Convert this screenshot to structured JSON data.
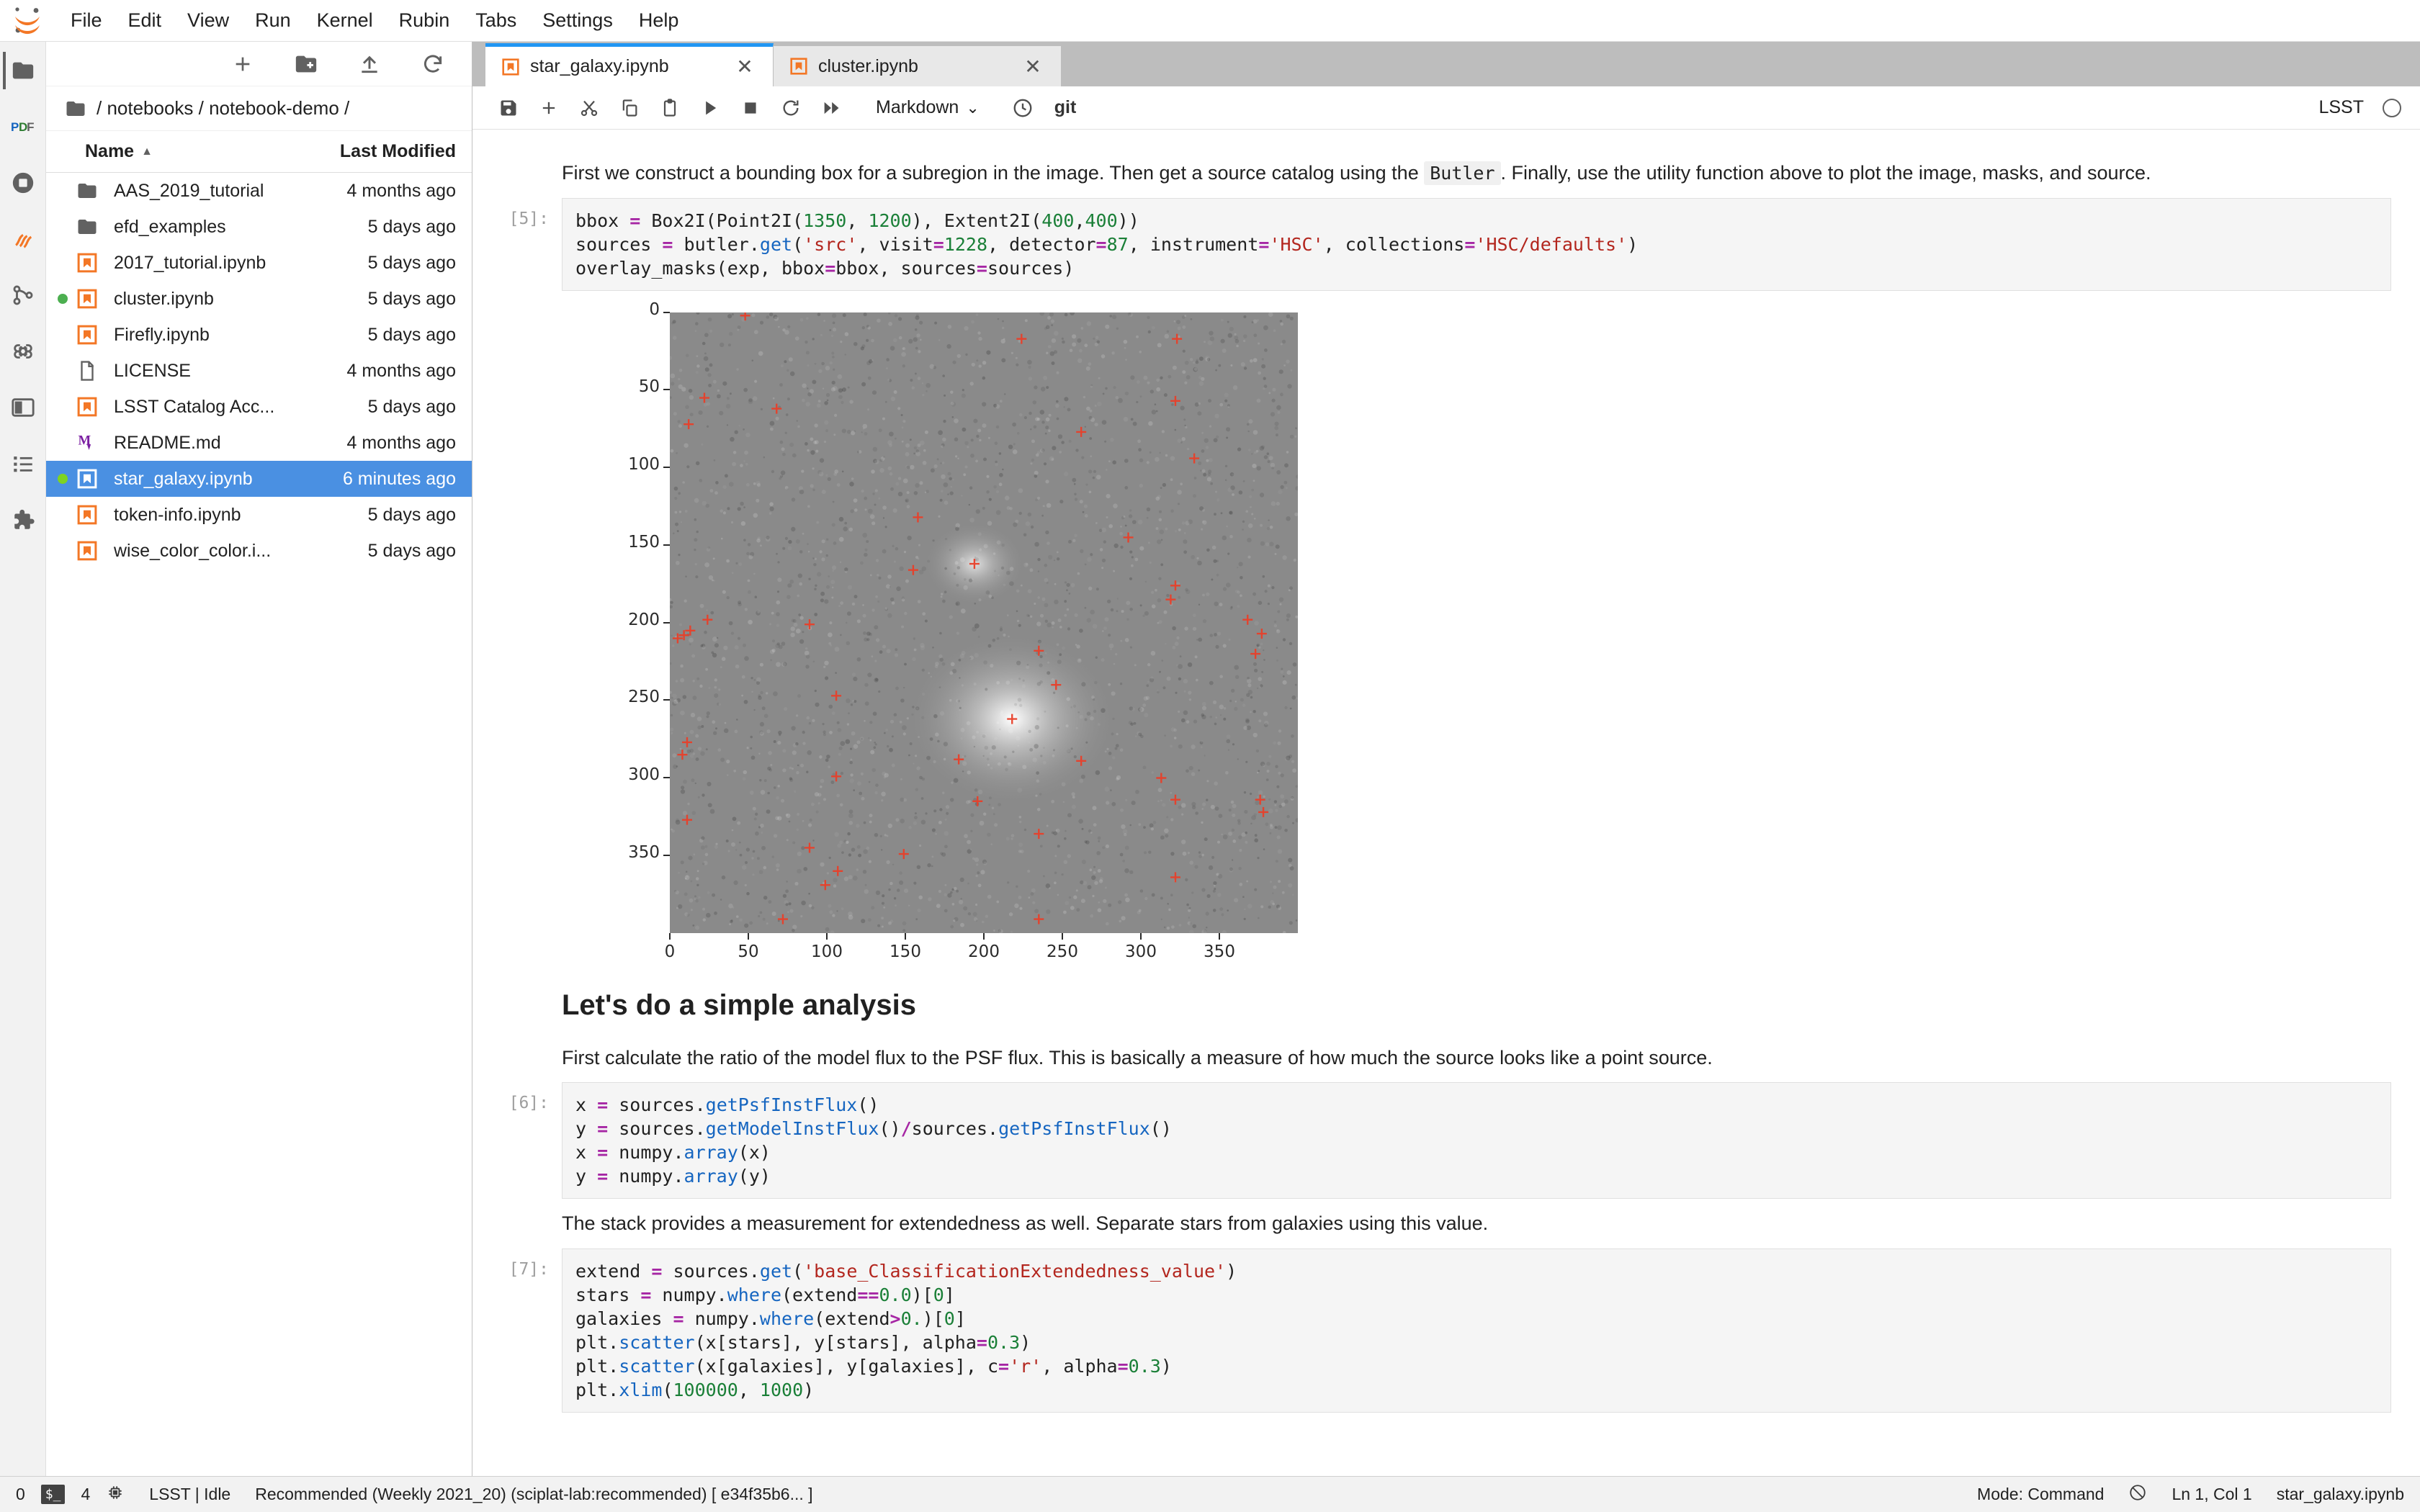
{
  "app": {
    "logo_icon": "jupyter-logo-icon",
    "menu": [
      "File",
      "Edit",
      "View",
      "Run",
      "Kernel",
      "Rubin",
      "Tabs",
      "Settings",
      "Help"
    ]
  },
  "activitybar": {
    "items": [
      {
        "name": "file-browser-icon",
        "label": "File Browser"
      },
      {
        "name": "pdf-icon",
        "label": "PDF"
      },
      {
        "name": "running-icon",
        "label": "Running Terminals and Kernels"
      },
      {
        "name": "dask-icon",
        "label": "Dask"
      },
      {
        "name": "git-icon",
        "label": "Git"
      },
      {
        "name": "commands-icon",
        "label": "Commands"
      },
      {
        "name": "property-inspector-icon",
        "label": "Property Inspector"
      },
      {
        "name": "toc-icon",
        "label": "Table of Contents"
      },
      {
        "name": "extensions-icon",
        "label": "Extension Manager"
      }
    ]
  },
  "filebrowser": {
    "toolbar": [
      {
        "name": "new-launcher-button",
        "icon": "plus-icon"
      },
      {
        "name": "new-folder-button",
        "icon": "folder-plus-icon"
      },
      {
        "name": "upload-button",
        "icon": "upload-icon"
      },
      {
        "name": "refresh-button",
        "icon": "refresh-icon"
      }
    ],
    "breadcrumb": "/ notebooks / notebook-demo /",
    "columns": {
      "name": "Name",
      "modified": "Last Modified"
    },
    "sort_caret": "▲",
    "items": [
      {
        "name": "AAS_2019_tutorial",
        "modified": "4 months ago",
        "type": "folder",
        "selected": false,
        "running": false
      },
      {
        "name": "efd_examples",
        "modified": "5 days ago",
        "type": "folder",
        "selected": false,
        "running": false
      },
      {
        "name": "2017_tutorial.ipynb",
        "modified": "5 days ago",
        "type": "notebook",
        "selected": false,
        "running": false
      },
      {
        "name": "cluster.ipynb",
        "modified": "5 days ago",
        "type": "notebook",
        "selected": false,
        "running": true
      },
      {
        "name": "Firefly.ipynb",
        "modified": "5 days ago",
        "type": "notebook",
        "selected": false,
        "running": false
      },
      {
        "name": "LICENSE",
        "modified": "4 months ago",
        "type": "file",
        "selected": false,
        "running": false
      },
      {
        "name": "LSST Catalog Acc...",
        "modified": "5 days ago",
        "type": "notebook",
        "selected": false,
        "running": false
      },
      {
        "name": "README.md",
        "modified": "4 months ago",
        "type": "markdown",
        "selected": false,
        "running": false
      },
      {
        "name": "star_galaxy.ipynb",
        "modified": "6 minutes ago",
        "type": "notebook",
        "selected": true,
        "running": true
      },
      {
        "name": "token-info.ipynb",
        "modified": "5 days ago",
        "type": "notebook",
        "selected": false,
        "running": false
      },
      {
        "name": "wise_color_color.i...",
        "modified": "5 days ago",
        "type": "notebook",
        "selected": false,
        "running": false
      }
    ]
  },
  "tabs": [
    {
      "label": "star_galaxy.ipynb",
      "close": "✕",
      "active": true
    },
    {
      "label": "cluster.ipynb",
      "close": "✕",
      "active": false
    }
  ],
  "notebook_toolbar": {
    "buttons": [
      {
        "name": "save-button",
        "icon": "save-icon"
      },
      {
        "name": "insert-cell-button",
        "icon": "plus-icon"
      },
      {
        "name": "cut-cell-button",
        "icon": "scissors-icon"
      },
      {
        "name": "copy-cell-button",
        "icon": "copy-icon"
      },
      {
        "name": "paste-cell-button",
        "icon": "paste-icon"
      },
      {
        "name": "run-cell-button",
        "icon": "play-icon"
      },
      {
        "name": "interrupt-kernel-button",
        "icon": "stop-icon"
      },
      {
        "name": "restart-kernel-button",
        "icon": "refresh-icon"
      },
      {
        "name": "restart-run-all-button",
        "icon": "fast-forward-icon"
      }
    ],
    "cell_type": "Markdown",
    "cell_type_caret": "⌄",
    "history_icon": "clock-icon",
    "git_label": "git",
    "kernel_name": "LSST"
  },
  "notebook": {
    "cells": [
      {
        "id": "md-intro",
        "type": "markdown",
        "prompt": "",
        "segments": [
          {
            "t": "text",
            "v": "First we construct a bounding box for a subregion in the image. Then get a source catalog using the "
          },
          {
            "t": "code",
            "v": "Butler"
          },
          {
            "t": "text",
            "v": ". Finally, use the utility function above to plot the image, masks, and source."
          }
        ]
      },
      {
        "id": "code-5",
        "type": "code",
        "prompt": "[5]:",
        "lines": [
          [
            {
              "t": "p",
              "v": "bbox "
            },
            {
              "t": "op",
              "v": "="
            },
            {
              "t": "p",
              "v": " Box2I(Point2I("
            },
            {
              "t": "num",
              "v": "1350"
            },
            {
              "t": "p",
              "v": ", "
            },
            {
              "t": "num",
              "v": "1200"
            },
            {
              "t": "p",
              "v": "), Extent2I("
            },
            {
              "t": "num",
              "v": "400"
            },
            {
              "t": "p",
              "v": ","
            },
            {
              "t": "num",
              "v": "400"
            },
            {
              "t": "p",
              "v": "))"
            }
          ],
          [
            {
              "t": "p",
              "v": "sources "
            },
            {
              "t": "op",
              "v": "="
            },
            {
              "t": "p",
              "v": " butler."
            },
            {
              "t": "fn",
              "v": "get"
            },
            {
              "t": "p",
              "v": "("
            },
            {
              "t": "str",
              "v": "'src'"
            },
            {
              "t": "p",
              "v": ", visit"
            },
            {
              "t": "op",
              "v": "="
            },
            {
              "t": "num",
              "v": "1228"
            },
            {
              "t": "p",
              "v": ", detector"
            },
            {
              "t": "op",
              "v": "="
            },
            {
              "t": "num",
              "v": "87"
            },
            {
              "t": "p",
              "v": ", instrument"
            },
            {
              "t": "op",
              "v": "="
            },
            {
              "t": "str",
              "v": "'HSC'"
            },
            {
              "t": "p",
              "v": ", collections"
            },
            {
              "t": "op",
              "v": "="
            },
            {
              "t": "str",
              "v": "'HSC/defaults'"
            },
            {
              "t": "p",
              "v": ")"
            }
          ],
          [
            {
              "t": "p",
              "v": "overlay_masks(exp, bbox"
            },
            {
              "t": "op",
              "v": "="
            },
            {
              "t": "p",
              "v": "bbox, sources"
            },
            {
              "t": "op",
              "v": "="
            },
            {
              "t": "p",
              "v": "sources)"
            }
          ]
        ]
      },
      {
        "id": "md-analysis-heading",
        "type": "markdown-heading",
        "prompt": "",
        "text": "Let's do a simple analysis"
      },
      {
        "id": "md-analysis-body",
        "type": "markdown",
        "prompt": "",
        "segments": [
          {
            "t": "text",
            "v": "First calculate the ratio of the model flux to the PSF flux. This is basically a measure of how much the source looks like a point source."
          }
        ]
      },
      {
        "id": "code-6",
        "type": "code",
        "prompt": "[6]:",
        "lines": [
          [
            {
              "t": "p",
              "v": "x "
            },
            {
              "t": "op",
              "v": "="
            },
            {
              "t": "p",
              "v": " sources."
            },
            {
              "t": "fn",
              "v": "getPsfInstFlux"
            },
            {
              "t": "p",
              "v": "()"
            }
          ],
          [
            {
              "t": "p",
              "v": "y "
            },
            {
              "t": "op",
              "v": "="
            },
            {
              "t": "p",
              "v": " sources."
            },
            {
              "t": "fn",
              "v": "getModelInstFlux"
            },
            {
              "t": "p",
              "v": "()"
            },
            {
              "t": "op",
              "v": "/"
            },
            {
              "t": "p",
              "v": "sources."
            },
            {
              "t": "fn",
              "v": "getPsfInstFlux"
            },
            {
              "t": "p",
              "v": "()"
            }
          ],
          [
            {
              "t": "p",
              "v": "x "
            },
            {
              "t": "op",
              "v": "="
            },
            {
              "t": "p",
              "v": " numpy."
            },
            {
              "t": "fn",
              "v": "array"
            },
            {
              "t": "p",
              "v": "(x)"
            }
          ],
          [
            {
              "t": "p",
              "v": "y "
            },
            {
              "t": "op",
              "v": "="
            },
            {
              "t": "p",
              "v": " numpy."
            },
            {
              "t": "fn",
              "v": "array"
            },
            {
              "t": "p",
              "v": "(y)"
            }
          ]
        ]
      },
      {
        "id": "md-extendedness",
        "type": "markdown",
        "prompt": "",
        "segments": [
          {
            "t": "text",
            "v": "The stack provides a measurement for extendedness as well. Separate stars from galaxies using this value."
          }
        ]
      },
      {
        "id": "code-7",
        "type": "code",
        "prompt": "[7]:",
        "lines": [
          [
            {
              "t": "p",
              "v": "extend "
            },
            {
              "t": "op",
              "v": "="
            },
            {
              "t": "p",
              "v": " sources."
            },
            {
              "t": "fn",
              "v": "get"
            },
            {
              "t": "p",
              "v": "("
            },
            {
              "t": "str",
              "v": "'base_ClassificationExtendedness_value'"
            },
            {
              "t": "p",
              "v": ")"
            }
          ],
          [
            {
              "t": "p",
              "v": "stars "
            },
            {
              "t": "op",
              "v": "="
            },
            {
              "t": "p",
              "v": " numpy."
            },
            {
              "t": "fn",
              "v": "where"
            },
            {
              "t": "p",
              "v": "(extend"
            },
            {
              "t": "op",
              "v": "=="
            },
            {
              "t": "num",
              "v": "0.0"
            },
            {
              "t": "p",
              "v": ")["
            },
            {
              "t": "num",
              "v": "0"
            },
            {
              "t": "p",
              "v": "]"
            }
          ],
          [
            {
              "t": "p",
              "v": "galaxies "
            },
            {
              "t": "op",
              "v": "="
            },
            {
              "t": "p",
              "v": " numpy."
            },
            {
              "t": "fn",
              "v": "where"
            },
            {
              "t": "p",
              "v": "(extend"
            },
            {
              "t": "op",
              "v": ">"
            },
            {
              "t": "num",
              "v": "0."
            },
            {
              "t": "p",
              "v": ")["
            },
            {
              "t": "num",
              "v": "0"
            },
            {
              "t": "p",
              "v": "]"
            }
          ],
          [
            {
              "t": "p",
              "v": "plt."
            },
            {
              "t": "fn",
              "v": "scatter"
            },
            {
              "t": "p",
              "v": "(x[stars], y[stars], alpha"
            },
            {
              "t": "op",
              "v": "="
            },
            {
              "t": "num",
              "v": "0.3"
            },
            {
              "t": "p",
              "v": ")"
            }
          ],
          [
            {
              "t": "p",
              "v": "plt."
            },
            {
              "t": "fn",
              "v": "scatter"
            },
            {
              "t": "p",
              "v": "(x[galaxies], y[galaxies], c"
            },
            {
              "t": "op",
              "v": "="
            },
            {
              "t": "str",
              "v": "'r'"
            },
            {
              "t": "p",
              "v": ", alpha"
            },
            {
              "t": "op",
              "v": "="
            },
            {
              "t": "num",
              "v": "0.3"
            },
            {
              "t": "p",
              "v": ")"
            }
          ],
          [
            {
              "t": "p",
              "v": "plt."
            },
            {
              "t": "fn",
              "v": "xlim"
            },
            {
              "t": "p",
              "v": "("
            },
            {
              "t": "num",
              "v": "100000"
            },
            {
              "t": "p",
              "v": ", "
            },
            {
              "t": "num",
              "v": "1000"
            },
            {
              "t": "p",
              "v": ")"
            }
          ]
        ]
      }
    ]
  },
  "chart_data": {
    "type": "heatmap",
    "title": "",
    "description": "Grayscale astronomical image cutout with red cross markers overlaid at detected source positions",
    "xlabel": "",
    "ylabel": "",
    "xlim": [
      0,
      400
    ],
    "ylim": [
      400,
      0
    ],
    "xticks": [
      0,
      50,
      100,
      150,
      200,
      250,
      300,
      350
    ],
    "yticks": [
      0,
      50,
      100,
      150,
      200,
      250,
      300,
      350
    ],
    "grid": false,
    "legend": "none",
    "marker": {
      "symbol": "+",
      "color": "#e8402a"
    },
    "background_color": "#8a8a8a",
    "blobs": [
      {
        "x": 218,
        "y": 262,
        "radius_px": 58,
        "peak": 1.0,
        "label": "galaxy"
      },
      {
        "x": 194,
        "y": 162,
        "radius_px": 28,
        "peak": 0.75,
        "label": "star"
      }
    ],
    "sources": [
      {
        "x": 48,
        "y": 2
      },
      {
        "x": 224,
        "y": 17
      },
      {
        "x": 323,
        "y": 17
      },
      {
        "x": 22,
        "y": 55
      },
      {
        "x": 322,
        "y": 57
      },
      {
        "x": 68,
        "y": 62
      },
      {
        "x": 12,
        "y": 72
      },
      {
        "x": 262,
        "y": 77
      },
      {
        "x": 334,
        "y": 94
      },
      {
        "x": 158,
        "y": 132
      },
      {
        "x": 292,
        "y": 145
      },
      {
        "x": 194,
        "y": 162
      },
      {
        "x": 155,
        "y": 166
      },
      {
        "x": 322,
        "y": 176
      },
      {
        "x": 319,
        "y": 185
      },
      {
        "x": 24,
        "y": 198
      },
      {
        "x": 368,
        "y": 198
      },
      {
        "x": 89,
        "y": 201
      },
      {
        "x": 13,
        "y": 205
      },
      {
        "x": 9,
        "y": 208
      },
      {
        "x": 5,
        "y": 210
      },
      {
        "x": 235,
        "y": 218
      },
      {
        "x": 377,
        "y": 207
      },
      {
        "x": 373,
        "y": 220
      },
      {
        "x": 246,
        "y": 240
      },
      {
        "x": 106,
        "y": 247
      },
      {
        "x": 218,
        "y": 262
      },
      {
        "x": 11,
        "y": 277
      },
      {
        "x": 8,
        "y": 285
      },
      {
        "x": 184,
        "y": 288
      },
      {
        "x": 262,
        "y": 289
      },
      {
        "x": 106,
        "y": 299
      },
      {
        "x": 313,
        "y": 300
      },
      {
        "x": 196,
        "y": 315
      },
      {
        "x": 322,
        "y": 314
      },
      {
        "x": 376,
        "y": 314
      },
      {
        "x": 378,
        "y": 322
      },
      {
        "x": 11,
        "y": 327
      },
      {
        "x": 235,
        "y": 336
      },
      {
        "x": 89,
        "y": 345
      },
      {
        "x": 149,
        "y": 349
      },
      {
        "x": 107,
        "y": 360
      },
      {
        "x": 322,
        "y": 364
      },
      {
        "x": 99,
        "y": 369
      },
      {
        "x": 72,
        "y": 391
      },
      {
        "x": 235,
        "y": 391
      }
    ]
  },
  "statusbar": {
    "terminals_count": "0",
    "terminal_icon": "terminal-icon",
    "kernels_count": "4",
    "kernel_icon": "chip-icon",
    "kernel_status": "LSST | Idle",
    "image_info": "Recommended (Weekly 2021_20) (sciplat-lab:recommended) [ e34f35b6... ]",
    "mode": "Mode: Command",
    "notifications_icon": "notification-off-icon",
    "cursor_position": "Ln 1, Col 1",
    "filename": "star_galaxy.ipynb"
  }
}
